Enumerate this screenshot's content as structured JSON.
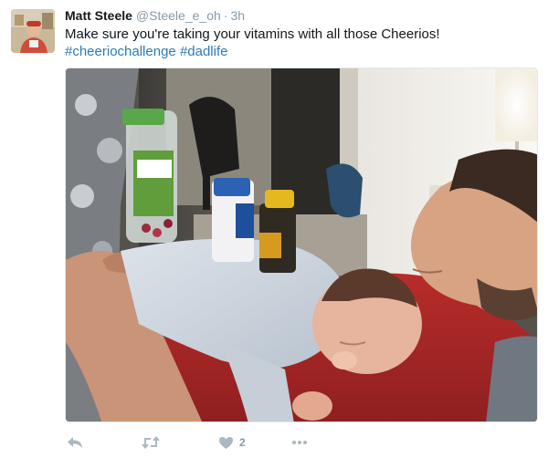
{
  "tweet": {
    "author_name": "Matt Steele",
    "author_handle": "@Steele_e_oh",
    "separator": "·",
    "timestamp": "3h",
    "text": "Make sure you're taking your vitamins with all those Cheerios!",
    "hashtags": [
      "#cheeriochallenge",
      "#dadlife"
    ],
    "likes_count": "2"
  },
  "icons": {
    "reply": "reply-icon",
    "retweet": "retweet-icon",
    "like": "heart-icon",
    "more": "more-dots-icon"
  },
  "colors": {
    "link": "#2b7bb9",
    "muted": "#8899a6",
    "icon": "#aab8c2"
  }
}
